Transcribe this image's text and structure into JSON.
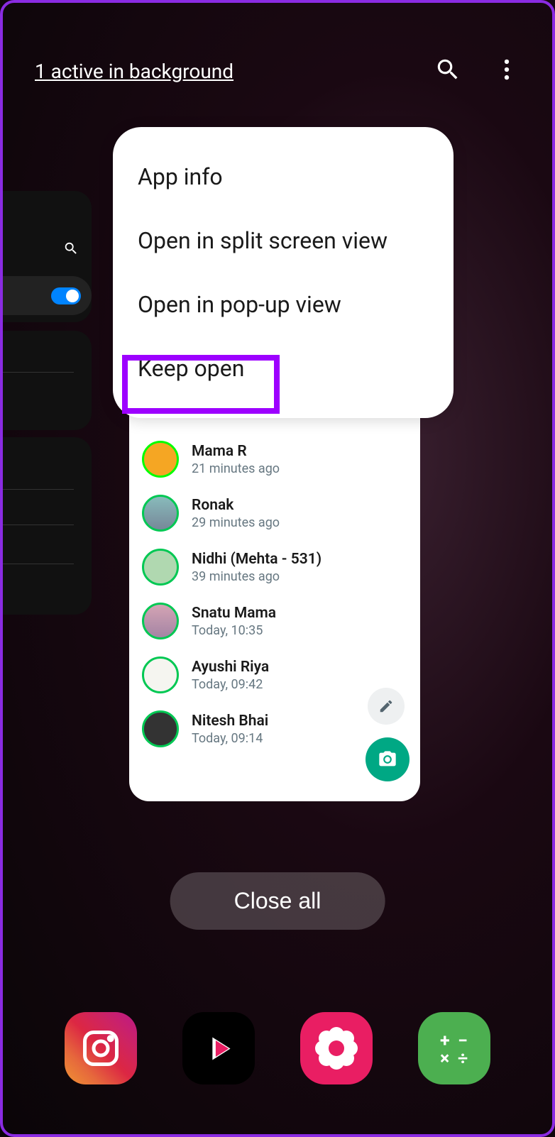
{
  "header": {
    "bg_link": "1 active in background"
  },
  "popup": {
    "app_info": "App info",
    "split_screen": "Open in split screen view",
    "popup_view": "Open in pop-up view",
    "keep_open": "Keep open"
  },
  "chats": [
    {
      "name": "Mama R",
      "time": "21 minutes ago",
      "avatar_color": "orange"
    },
    {
      "name": "Ronak",
      "time": "29 minutes ago",
      "avatar_color": "blue"
    },
    {
      "name": "Nidhi (Mehta - 531)",
      "time": "39 minutes ago",
      "avatar_color": "green"
    },
    {
      "name": "Snatu Mama",
      "time": "Today, 10:35",
      "avatar_color": "pink"
    },
    {
      "name": "Ayushi Riya",
      "time": "Today, 09:42",
      "avatar_color": "white"
    },
    {
      "name": "Nitesh Bhai",
      "time": "Today, 09:14",
      "avatar_color": "dark"
    }
  ],
  "close_all": "Close all",
  "dock": {
    "instagram": "instagram",
    "youtube": "youtube",
    "gallery": "gallery",
    "calculator": "calculator"
  }
}
